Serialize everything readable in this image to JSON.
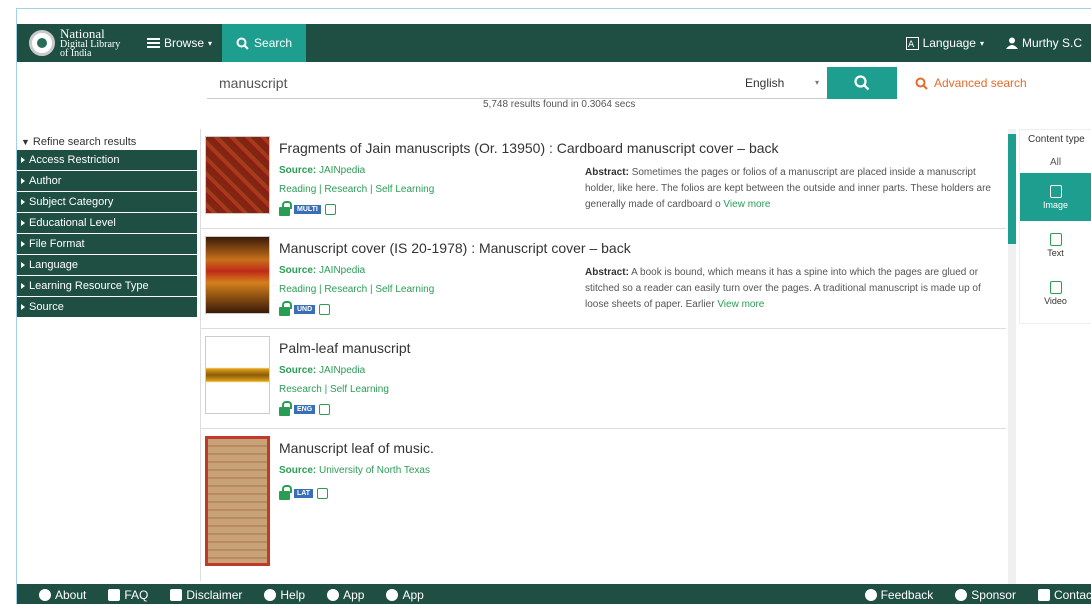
{
  "nav": {
    "logo_line1": "National",
    "logo_line2": "Digital Library",
    "logo_line3": "of India",
    "browse_label": "Browse",
    "search_tab_label": "Search",
    "language_label": "Language",
    "user_label": "Murthy S.C"
  },
  "search": {
    "query": "manuscript",
    "language": "English",
    "advanced_label": "Advanced search",
    "results_count": "5,748 results found in 0.3064 secs"
  },
  "refine": {
    "title": "Refine search results",
    "items": [
      {
        "label": "Access Restriction"
      },
      {
        "label": "Author"
      },
      {
        "label": "Subject Category"
      },
      {
        "label": "Educational Level"
      },
      {
        "label": "File Format"
      },
      {
        "label": "Language"
      },
      {
        "label": "Learning Resource Type"
      },
      {
        "label": "Source"
      }
    ]
  },
  "results": [
    {
      "title": "Fragments of Jain manuscripts (Or. 13950) : Cardboard manuscript cover – back",
      "source_label": "Source:",
      "source": "JAINpedia",
      "cats": "Reading  |  Research  |  Self Learning",
      "badge": "MULTI",
      "abstract_label": "Abstract:",
      "abstract": "Sometimes the pages or folios of a manuscript are placed inside a manuscript holder, like here. The folios are kept between the outside and inner parts. These holders are generally made of cardboard o",
      "view_more": "View more"
    },
    {
      "title": "Manuscript cover (IS 20-1978) : Manuscript cover – back",
      "source_label": "Source:",
      "source": "JAINpedia",
      "cats": "Reading  |  Research  |  Self Learning",
      "badge": "UND",
      "abstract_label": "Abstract:",
      "abstract": "A book is bound, which means it has a spine into which the pages are glued or stitched so a reader can easily turn over the pages. A traditional manuscript is made up of loose sheets of paper. Earlier",
      "view_more": "View more"
    },
    {
      "title": "Palm-leaf manuscript",
      "source_label": "Source:",
      "source": "JAINpedia",
      "cats": "Research  |  Self Learning",
      "badge": "ENG",
      "abstract_label": "",
      "abstract": "",
      "view_more": ""
    },
    {
      "title": "Manuscript leaf of music.",
      "source_label": "Source:",
      "source": "University of North Texas",
      "cats": "",
      "badge": "LAT",
      "abstract_label": "",
      "abstract": "",
      "view_more": ""
    }
  ],
  "content_type": {
    "title": "Content type",
    "all": "All",
    "items": [
      {
        "label": "Image"
      },
      {
        "label": "Text"
      },
      {
        "label": "Video"
      }
    ]
  },
  "footer": {
    "about": "About",
    "faq": "FAQ",
    "disclaimer": "Disclaimer",
    "help": "Help",
    "app1": "App",
    "app2": "App",
    "feedback": "Feedback",
    "sponsor": "Sponsor",
    "contact": "Contac"
  },
  "colors": {
    "nav_bg": "#1f4f42",
    "accent": "#1e9e8e",
    "link_green": "#2a9d55",
    "advanced": "#e86a2a"
  }
}
